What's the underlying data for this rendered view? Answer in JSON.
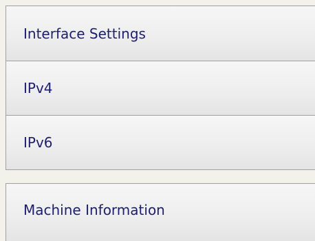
{
  "menu": {
    "group_1": [
      {
        "label": "Interface Settings"
      },
      {
        "label": "IPv4"
      },
      {
        "label": "IPv6"
      }
    ],
    "group_2": [
      {
        "label": "Machine Information"
      }
    ]
  }
}
